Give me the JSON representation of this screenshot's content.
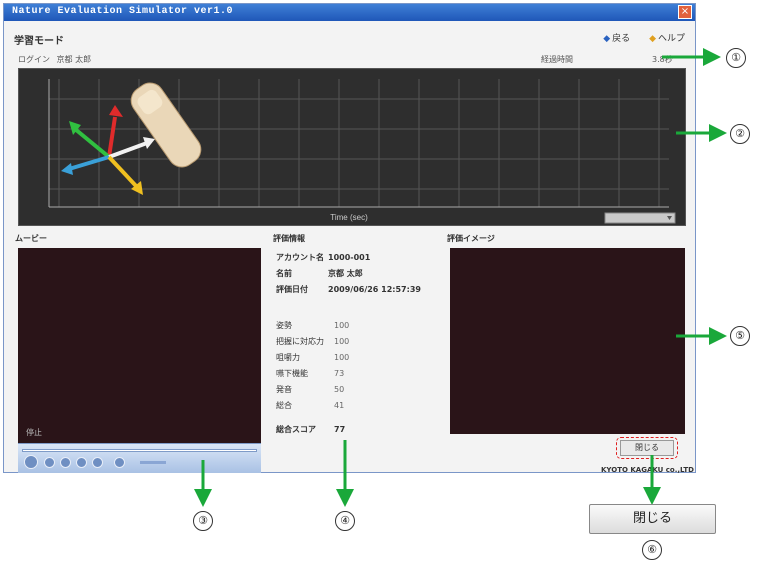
{
  "window": {
    "title": "Nature Evaluation Simulator ver1.0",
    "close_glyph": "×"
  },
  "header": {
    "mode": "学習モード",
    "links": [
      {
        "label": "戻る",
        "icon": "back-arrow-icon"
      },
      {
        "label": "ヘルプ",
        "icon": "help-icon"
      }
    ]
  },
  "subheader": {
    "login_label": "ログイン",
    "user": "京都 太郎",
    "time_label": "経過時間",
    "time_value": "3.8秒"
  },
  "chart": {
    "xlabel": "Time (sec)",
    "ylabel": "",
    "axis_colors": {
      "x": "#e8e8e8",
      "y": "#e02b2b",
      "z": "#3aa0d8",
      "w": "#f0c020",
      "v": "#30c040"
    }
  },
  "movie": {
    "label": "ムービー",
    "caption": "停止"
  },
  "eval_info": {
    "label": "評価情報",
    "account_label": "アカウント名",
    "account": "1000-001",
    "name_label": "名前",
    "name": "京都 太郎",
    "date_label": "評価日付",
    "date": "2009/06/26 12:57:39",
    "scores": [
      {
        "label": "姿勢",
        "value": "100"
      },
      {
        "label": "把握に対応力",
        "value": "100"
      },
      {
        "label": "咀嚼力",
        "value": "100"
      },
      {
        "label": "嚥下機能",
        "value": "73"
      },
      {
        "label": "発音",
        "value": "50"
      },
      {
        "label": "総合",
        "value": "41"
      }
    ],
    "total_label": "総合スコア",
    "total": "77"
  },
  "eval_image": {
    "label": "評価イメージ"
  },
  "buttons": {
    "close_small": "閉じる",
    "close_big": "閉じる"
  },
  "footer": {
    "company": "KYOTO KAGAKU co.,LTD"
  },
  "callouts": [
    "①",
    "②",
    "③",
    "④",
    "⑤",
    "⑥"
  ]
}
